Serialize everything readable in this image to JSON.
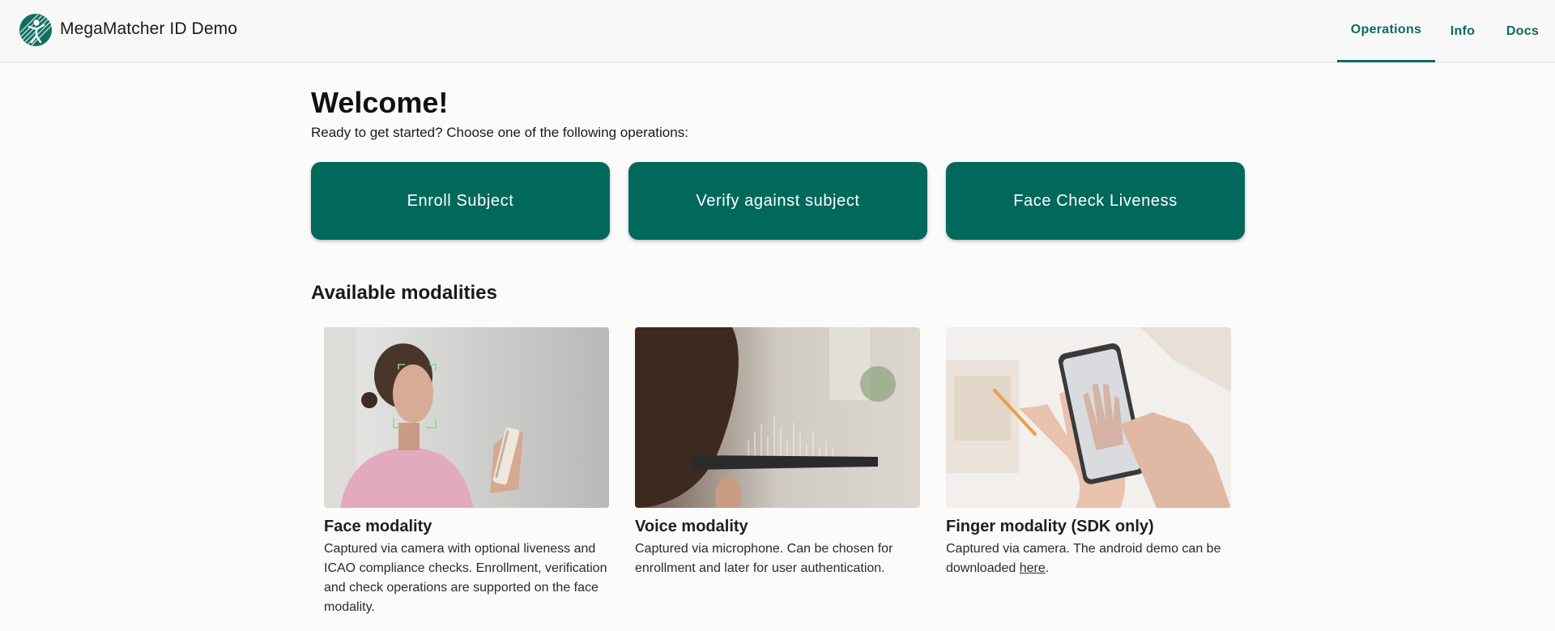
{
  "header": {
    "title": "MegaMatcher ID Demo",
    "logo": "megamatcher-logo-icon",
    "tabs": [
      {
        "label": "Operations",
        "active": true
      },
      {
        "label": "Info",
        "active": false
      },
      {
        "label": "Docs",
        "active": false
      }
    ]
  },
  "main": {
    "heading": "Welcome!",
    "subtitle": "Ready to get started? Choose one of the following operations:",
    "operations": [
      {
        "label": "Enroll Subject"
      },
      {
        "label": "Verify against subject"
      },
      {
        "label": "Face Check Liveness"
      }
    ],
    "modalities_heading": "Available modalities",
    "modalities": [
      {
        "title": "Face modality",
        "description": "Captured via camera with optional liveness and ICAO compliance checks. Enrollment, verification and check operations are supported on the face modality.",
        "image": "face-photo"
      },
      {
        "title": "Voice modality",
        "description": "Captured via microphone. Can be chosen for enrollment and later for user authentication.",
        "image": "voice-photo"
      },
      {
        "title": "Finger modality (SDK only)",
        "description_prefix": "Captured via camera. The android demo can be downloaded ",
        "link_text": "here",
        "description_suffix": ".",
        "image": "finger-photo"
      }
    ]
  },
  "colors": {
    "primary": "#01695c",
    "nav_accent": "#0d6b5e",
    "background": "#fbfbfb",
    "header_bg": "#f8f8f8"
  }
}
